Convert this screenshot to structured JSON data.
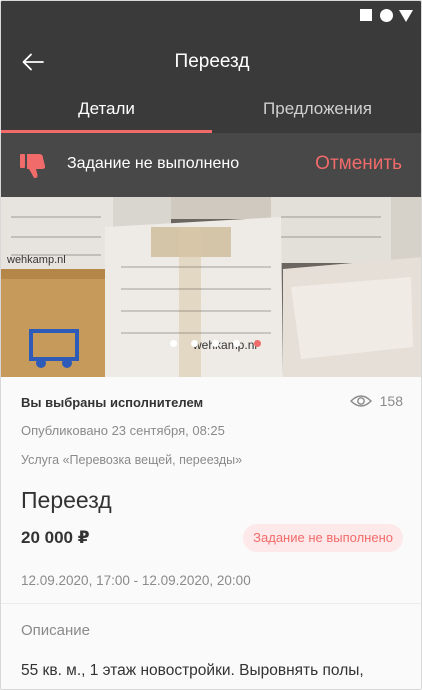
{
  "header": {
    "title": "Переезд",
    "back_icon": "arrow-left-icon"
  },
  "tabs": [
    {
      "label": "Детали",
      "active": true
    },
    {
      "label": "Предложения",
      "active": false
    }
  ],
  "banner": {
    "icon": "thumbs-down-icon",
    "text": "Задание не выполнено",
    "action_label": "Отменить"
  },
  "photo": {
    "box_labels": [
      "wehkamp.nl",
      "wehkamp.nl"
    ],
    "slides": 5,
    "active_slide": 5
  },
  "task": {
    "selected_text": "Вы выбраны исполнителем",
    "views": "158",
    "published": "Опубликовано 23 сентября, 08:25",
    "service": "Услуга «Перевозка вещей, переезды»",
    "title": "Переезд",
    "price": "20 000 ₽",
    "status": "Задание не выполнено",
    "dates": "12.09.2020, 17:00 - 12.09.2020, 20:00",
    "description_label": "Описание",
    "description": "55 кв. м., 1 этаж новостройки. Выровнять полы,"
  },
  "colors": {
    "accent": "#f26b6b",
    "header_bg": "#3a3a3a",
    "banner_bg": "#484848"
  }
}
